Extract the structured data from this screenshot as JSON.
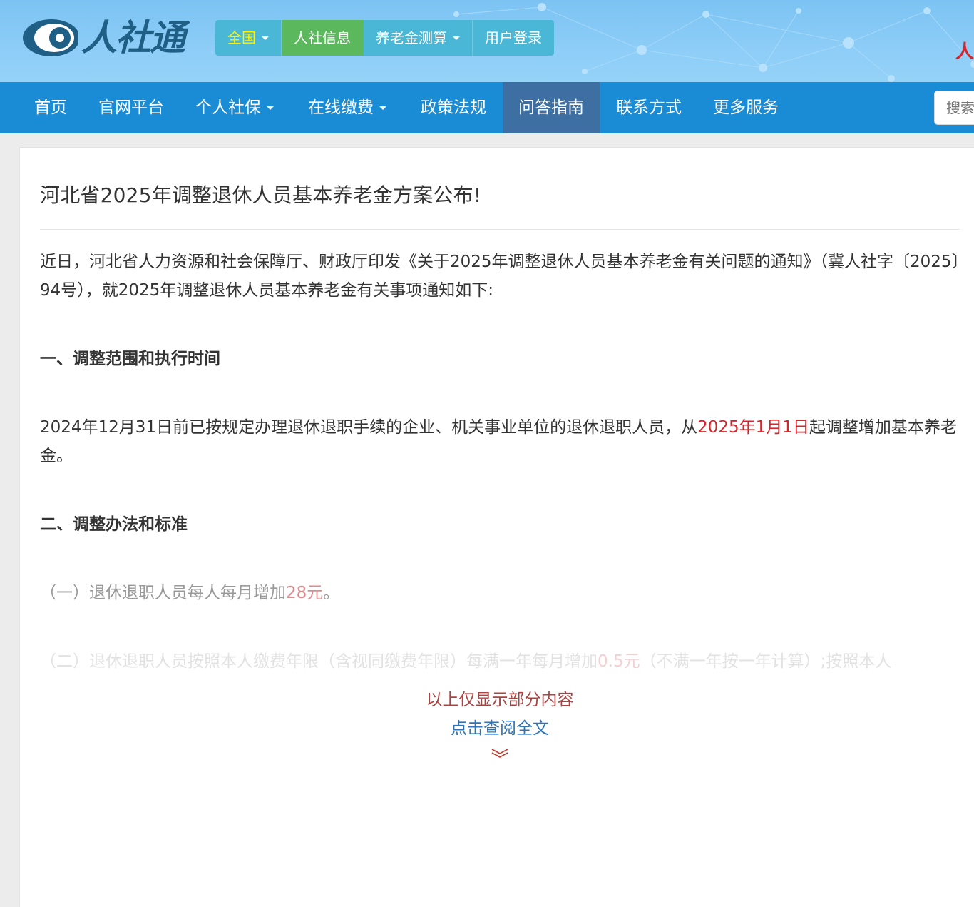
{
  "brand": {
    "logo_text": "人社通",
    "right_text": "人"
  },
  "topnav": [
    {
      "label": "全国",
      "dropdown": true
    },
    {
      "label": "人社信息",
      "dropdown": false
    },
    {
      "label": "养老金测算",
      "dropdown": true
    },
    {
      "label": "用户登录",
      "dropdown": false
    }
  ],
  "mainnav": [
    {
      "label": "首页"
    },
    {
      "label": "官网平台"
    },
    {
      "label": "个人社保",
      "dropdown": true
    },
    {
      "label": "在线缴费",
      "dropdown": true
    },
    {
      "label": "政策法规"
    },
    {
      "label": "问答指南",
      "active": true
    },
    {
      "label": "联系方式"
    },
    {
      "label": "更多服务"
    }
  ],
  "search": {
    "placeholder": "搜索"
  },
  "article": {
    "title": "河北省2025年调整退休人员基本养老金方案公布!",
    "intro": "近日，河北省人力资源和社会保障厅、财政厅印发《关于2025年调整退休人员基本养老金有关问题的通知》（冀人社字〔2025〕94号），就2025年调整退休人员基本养老金有关事项通知如下:",
    "section1_heading": "一、调整范围和执行时间",
    "section1_text_a": "2024年12月31日前已按规定办理退休退职手续的企业、机关事业单位的退休退职人员，从",
    "section1_highlight": "2025年1月1日",
    "section1_text_b": "起调整增加基本养老金。",
    "section2_heading": "二、调整办法和标准",
    "item1_text_a": "（一）退休退职人员每人每月增加",
    "item1_highlight": "28元",
    "item1_text_b": "。",
    "item2_text_a": "（二）退休退职人员按照本人缴费年限（含视同缴费年限）每满一年每月增加",
    "item2_highlight": "0.5元",
    "item2_text_b": "（不满一年按一年计算）;按照本人"
  },
  "more": {
    "note": "以上仅显示部分内容",
    "link": "点击查阅全文"
  },
  "colors": {
    "header_bg": "#7cc3f3",
    "mainnav_bg": "#1a8bd5",
    "mainnav_active": "#3e6fa3",
    "topnav_bg": "#4bb7d6",
    "topnav_active": "#5cb85c",
    "highlight_red": "#d9242a",
    "link_blue": "#2f74b5"
  }
}
